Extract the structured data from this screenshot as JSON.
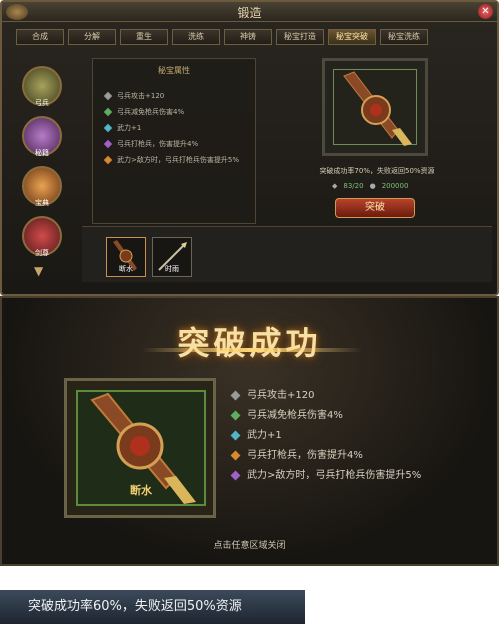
{
  "window": {
    "title": "锻造",
    "close_glyph": "✕"
  },
  "tabs": [
    {
      "label": "合成"
    },
    {
      "label": "分解"
    },
    {
      "label": "重生"
    },
    {
      "label": "洗练"
    },
    {
      "label": "神铸"
    },
    {
      "label": "秘宝打造"
    },
    {
      "label": "秘宝突破",
      "active": true
    },
    {
      "label": "秘宝洗练"
    }
  ],
  "sidebar": [
    {
      "label": "弓兵",
      "icon": "bow-soldier-icon"
    },
    {
      "label": "秘籍",
      "icon": "scroll-icon"
    },
    {
      "label": "宝典",
      "icon": "book-icon"
    },
    {
      "label": "剑尊",
      "icon": "sword-icon"
    }
  ],
  "attributes_panel": {
    "heading": "秘宝属性",
    "items": [
      {
        "text": "弓兵攻击+120",
        "color": "#9a9a9a"
      },
      {
        "text": "弓兵减免枪兵伤害4%",
        "color": "#5fae5f"
      },
      {
        "text": "武力+1",
        "color": "#4fb7c9"
      },
      {
        "text": "弓兵打枪兵，伤害提升4%",
        "color": "#a05fc9"
      },
      {
        "text": "武力>敌方时，弓兵打枪兵伤害提升5%",
        "color": "#d98a2f"
      }
    ]
  },
  "breakthrough": {
    "rate_text": "突破成功率70%，失败返回50%资源",
    "cost_item": "83/20",
    "cost_silver": "200000",
    "button_label": "突破"
  },
  "slots": [
    {
      "label": "断水",
      "selected": true
    },
    {
      "label": "时雨",
      "selected": false
    }
  ],
  "popup": {
    "title": "突破成功",
    "weapon_name": "断水",
    "attributes": [
      {
        "text": "弓兵攻击+120",
        "color": "#9a9a9a"
      },
      {
        "text": "弓兵减免枪兵伤害4%",
        "color": "#5fae5f"
      },
      {
        "text": "武力+1",
        "color": "#4fb7c9"
      },
      {
        "text": "弓兵打枪兵，伤害提升4%",
        "color": "#d98a2f"
      },
      {
        "text": "武力>敌方时，弓兵打枪兵伤害提升5%",
        "color": "#a05fc9"
      }
    ],
    "close_hint": "点击任意区域关闭"
  },
  "banner": {
    "text": "突破成功率60%，失败返回50%资源"
  }
}
